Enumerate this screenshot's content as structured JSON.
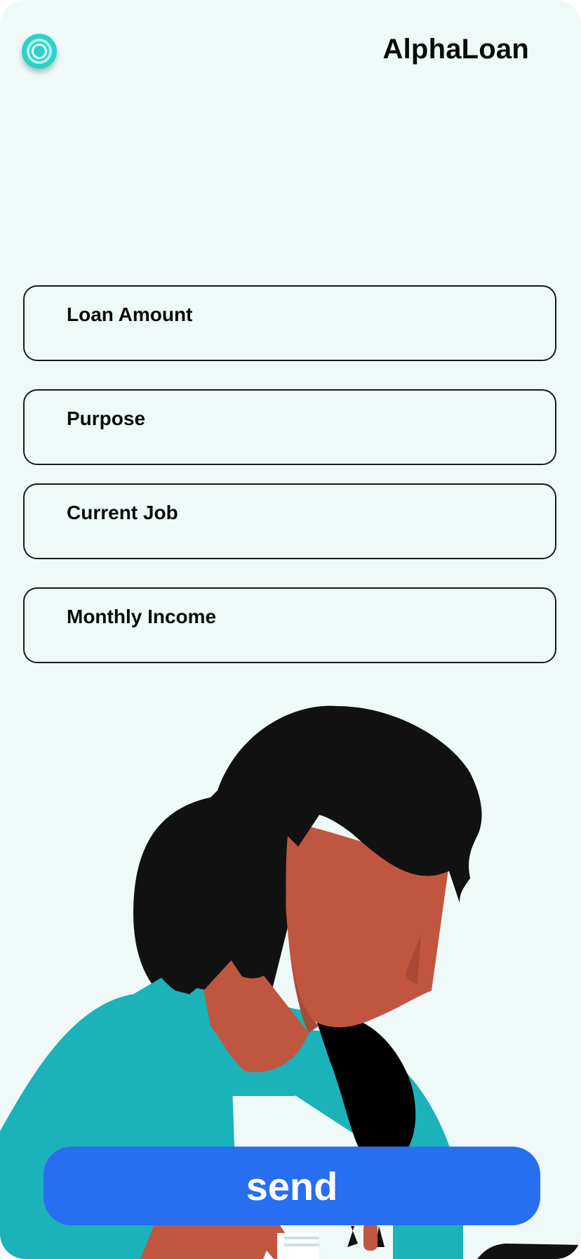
{
  "header": {
    "logo_icon": "target-logo-icon",
    "brand": "AlphaLoan"
  },
  "form": {
    "fields": [
      {
        "label": "Loan Amount"
      },
      {
        "label": "Purpose"
      },
      {
        "label": "Current Job"
      },
      {
        "label": "Monthly Income"
      }
    ],
    "send_label": "send"
  },
  "colors": {
    "background": "#eef9f8",
    "accent_button": "#276ef1",
    "logo_teal": "#2ad3c8",
    "shirt_teal": "#1bb2b9",
    "skin": "#c15640",
    "hair": "#111111"
  },
  "illustration": {
    "subject": "woman-with-dark-hair-looking-down"
  }
}
